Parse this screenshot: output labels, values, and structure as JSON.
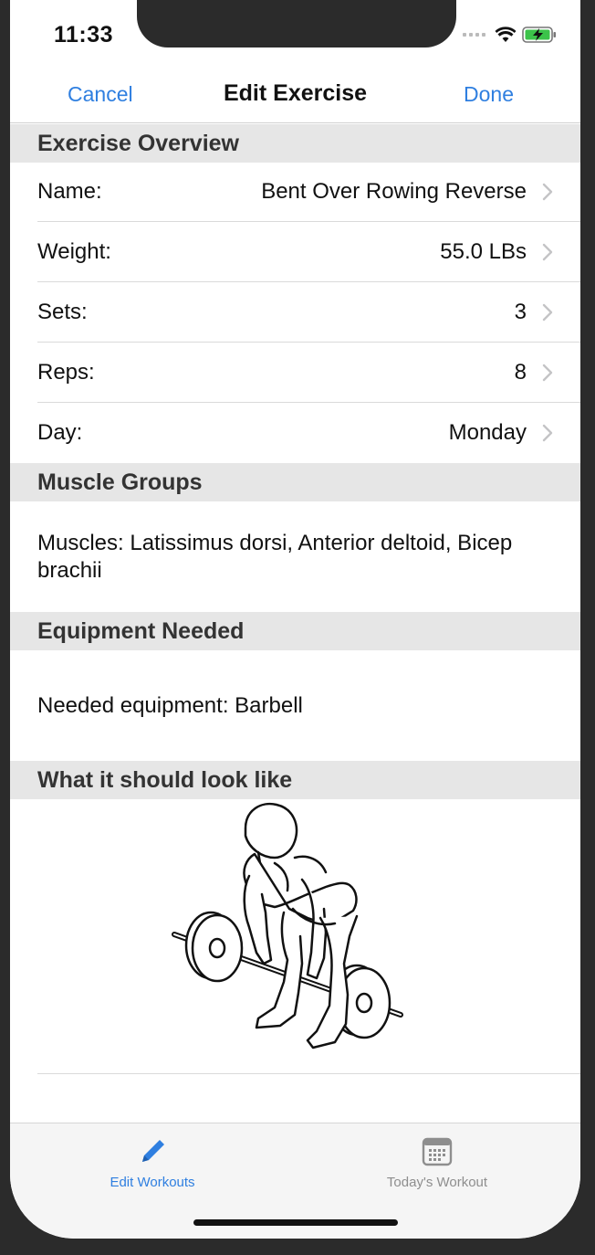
{
  "status": {
    "time": "11:33"
  },
  "nav": {
    "cancel": "Cancel",
    "title": "Edit Exercise",
    "done": "Done"
  },
  "sections": {
    "overview": "Exercise Overview",
    "muscles": "Muscle Groups",
    "equipment": "Equipment Needed",
    "image": "What it should look like"
  },
  "rows": [
    {
      "label": "Name:",
      "value": "Bent Over Rowing Reverse"
    },
    {
      "label": "Weight:",
      "value": "55.0 LBs"
    },
    {
      "label": "Sets:",
      "value": "3"
    },
    {
      "label": "Reps:",
      "value": "8"
    },
    {
      "label": "Day:",
      "value": "Monday"
    }
  ],
  "muscles_text": "Muscles: Latissimus dorsi, Anterior deltoid, Bicep brachii",
  "equipment_text": "Needed equipment: Barbell",
  "tabs": [
    {
      "label": "Edit Workouts",
      "icon": "pencil-icon"
    },
    {
      "label": "Today's Workout",
      "icon": "calendar-icon"
    }
  ],
  "colors": {
    "accent": "#2f7fe0",
    "section_bg": "#e6e6e6",
    "inactive_tab": "#8e8e8e"
  }
}
